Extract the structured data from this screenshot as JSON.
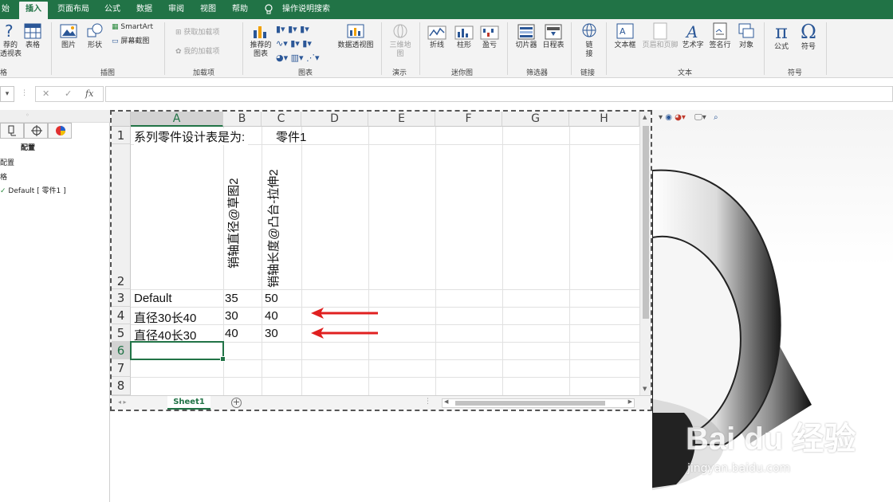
{
  "ribbon_tabs": [
    "始",
    "插入",
    "页面布局",
    "公式",
    "数据",
    "审阅",
    "视图",
    "帮助",
    "操作说明搜索"
  ],
  "active_tab": "插入",
  "ribbon": {
    "tables": {
      "pivot_label_a": "荐的",
      "pivot_label_b": "透视表",
      "table_label": "表格",
      "group": "格"
    },
    "illustrations": {
      "picture": "图片",
      "shapes": "形状",
      "smartart": "SmartArt",
      "screenshot": "屏幕截图",
      "group": "插图"
    },
    "addins": {
      "get": "获取加载项",
      "mine": "我的加载项",
      "group": "加载项"
    },
    "charts": {
      "recommended_a": "推荐的",
      "recommended_b": "图表",
      "pivotchart": "数据透视图",
      "group": "图表"
    },
    "tours": {
      "map3d_a": "三维地",
      "map3d_b": "图",
      "group": "演示"
    },
    "sparklines": {
      "line": "折线",
      "column": "柱形",
      "winloss": "盈亏",
      "group": "迷你图"
    },
    "filters": {
      "slicer": "切片器",
      "timeline": "日程表",
      "group": "筛选器"
    },
    "links": {
      "link_a": "链",
      "link_b": "接",
      "group": "链接"
    },
    "text": {
      "textbox": "文本框",
      "headerfooter": "页眉和页脚",
      "wordart": "艺术字",
      "signature": "签名行",
      "object": "对象",
      "group": "文本"
    },
    "symbols": {
      "equation": "公式",
      "symbol": "符号",
      "group": "符号"
    }
  },
  "formula_bar": {
    "cancel": "✕",
    "enter": "✓",
    "fx": "fx"
  },
  "left_panel": {
    "heading": "配置",
    "item1": "配置",
    "item2": "格",
    "item3": "Default [ 零件1 ]"
  },
  "sheet": {
    "columns": [
      "A",
      "B",
      "C",
      "D",
      "E",
      "F",
      "G",
      "H"
    ],
    "rows": [
      "1",
      "2",
      "3",
      "4",
      "5",
      "6",
      "7",
      "8"
    ],
    "r1_a": "系列零件设计表是为:",
    "r1_c": "零件1",
    "r2_b": "销轴直径@草图2",
    "r2_c": "销轴长度@凸台-拉伸2",
    "r3": [
      "Default",
      "35",
      "50"
    ],
    "r4": [
      "直径30长40",
      "30",
      "40"
    ],
    "r5": [
      "直径40长30",
      "40",
      "30"
    ],
    "selected_cell": "A6",
    "sheet_tab": "Sheet1"
  },
  "watermark": {
    "brand": "Bai du 经验",
    "url": "jingyan.baidu.com"
  },
  "colors": {
    "excel_green": "#217346",
    "arrow_red": "#e02020"
  }
}
